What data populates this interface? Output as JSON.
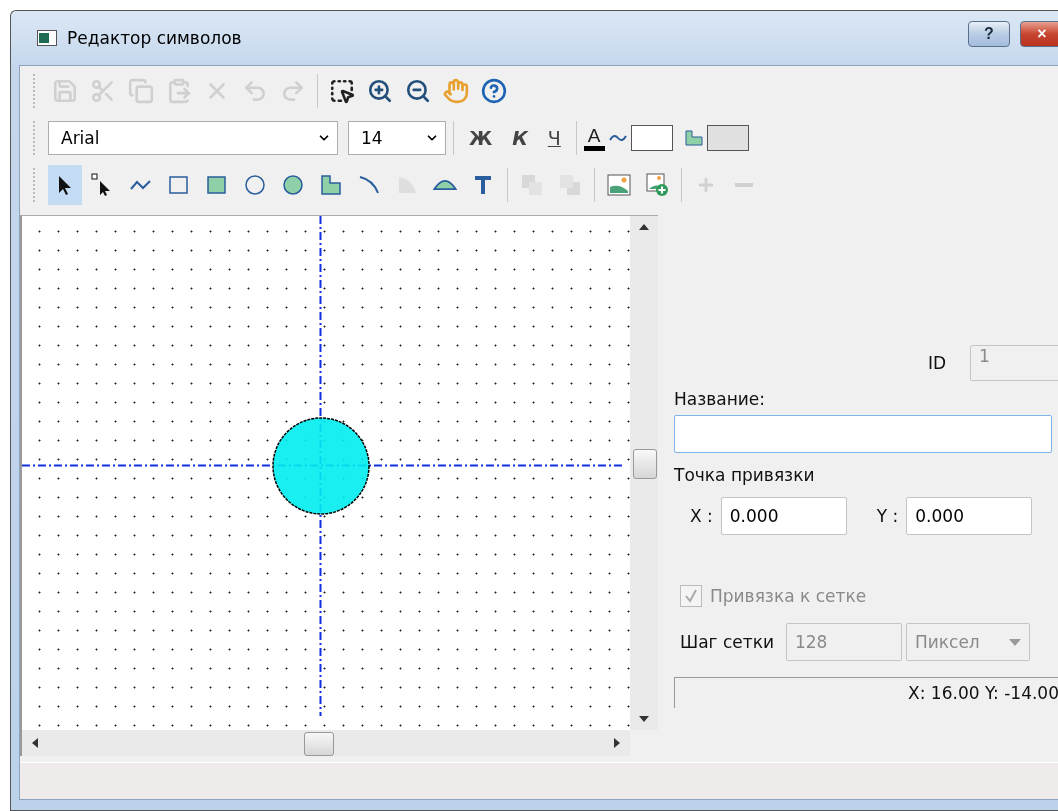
{
  "window": {
    "title": "Редактор символов",
    "help_button": "?",
    "close_button": "×"
  },
  "main_toolbar": [
    {
      "kind": "save",
      "disabled": true
    },
    {
      "kind": "cut",
      "disabled": true
    },
    {
      "kind": "copy",
      "disabled": true
    },
    {
      "kind": "paste",
      "disabled": true
    },
    {
      "kind": "delete",
      "disabled": true
    },
    {
      "kind": "undo",
      "disabled": true
    },
    {
      "kind": "redo",
      "disabled": true
    },
    {
      "kind": "separator"
    },
    {
      "kind": "select-area",
      "disabled": false
    },
    {
      "kind": "zoom-in",
      "disabled": false
    },
    {
      "kind": "zoom-out",
      "disabled": false
    },
    {
      "kind": "hand",
      "disabled": false
    },
    {
      "kind": "help",
      "disabled": false
    }
  ],
  "format_bar": {
    "font": "Arial",
    "size": "14",
    "bold": "Ж",
    "italic": "К",
    "underline": "Ч",
    "text_color": "A"
  },
  "draw_tools": [
    {
      "kind": "pointer",
      "selected": true,
      "disabled": false
    },
    {
      "kind": "node-pointer",
      "selected": false,
      "disabled": false
    },
    {
      "kind": "polyline",
      "selected": false,
      "disabled": false
    },
    {
      "kind": "rect",
      "selected": false,
      "disabled": false
    },
    {
      "kind": "filled-rect",
      "selected": false,
      "disabled": false
    },
    {
      "kind": "circle",
      "selected": false,
      "disabled": false
    },
    {
      "kind": "filled-circle",
      "selected": false,
      "disabled": false
    },
    {
      "kind": "polygon",
      "selected": false,
      "disabled": false
    },
    {
      "kind": "arc",
      "selected": false,
      "disabled": false
    },
    {
      "kind": "sector",
      "selected": false,
      "disabled": true
    },
    {
      "kind": "chord",
      "selected": false,
      "disabled": false
    },
    {
      "kind": "text",
      "selected": false,
      "disabled": false
    },
    {
      "kind": "separator"
    },
    {
      "kind": "bring-front",
      "selected": false,
      "disabled": true
    },
    {
      "kind": "send-back",
      "selected": false,
      "disabled": true
    },
    {
      "kind": "separator"
    },
    {
      "kind": "image",
      "selected": false,
      "disabled": false
    },
    {
      "kind": "add-image",
      "selected": false,
      "disabled": false
    },
    {
      "kind": "separator"
    },
    {
      "kind": "plus",
      "selected": false,
      "disabled": true
    },
    {
      "kind": "minus",
      "selected": false,
      "disabled": true
    }
  ],
  "properties": {
    "id_label": "ID",
    "id_value": "1",
    "name_label": "Название:",
    "anchor_label": "Точка привязки",
    "x_label": "X :",
    "x_value": "0.000",
    "y_label": "Y :",
    "y_value": "0.000",
    "snap": {
      "label": "Привязка к сетке",
      "checked": true,
      "disabled": true
    },
    "grid_step_label": "Шаг сетки",
    "grid_step_value": "128",
    "grid_unit": "Пиксел",
    "cursor_coords": "X: 16.00  Y: -14.00"
  }
}
